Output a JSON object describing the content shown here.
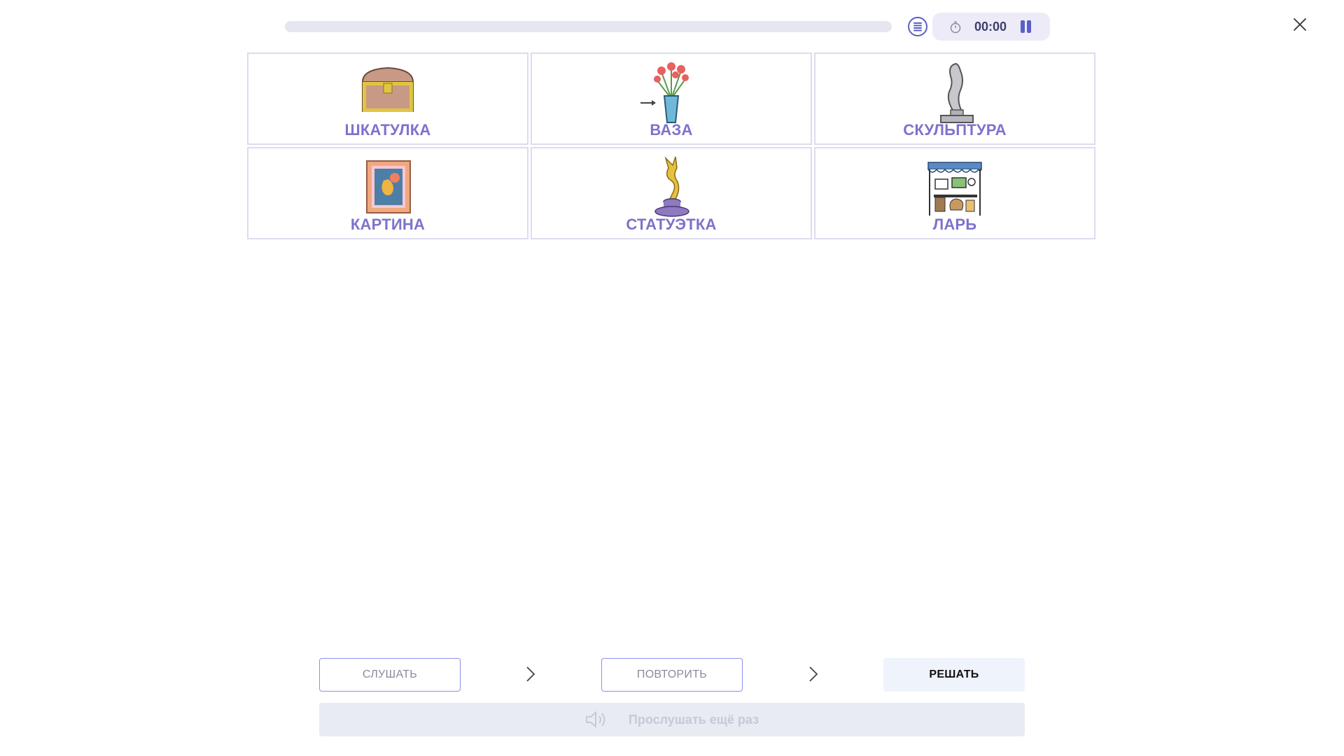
{
  "topbar": {
    "progress": 0,
    "timer": "00:00",
    "icons": {
      "list": "list-icon",
      "timer": "stopwatch-icon",
      "pause": "pause-icon",
      "close": "close-icon"
    }
  },
  "cards": [
    {
      "label": "ШКАТУЛКА",
      "icon": "chest-icon"
    },
    {
      "label": "ВАЗА",
      "icon": "vase-icon"
    },
    {
      "label": "СКУЛЬПТУРА",
      "icon": "sculpture-icon"
    },
    {
      "label": "КАРТИНА",
      "icon": "painting-icon"
    },
    {
      "label": "СТАТУЭТКА",
      "icon": "statuette-icon"
    },
    {
      "label": "ЛАРЬ",
      "icon": "stall-icon"
    }
  ],
  "steps": {
    "listen": "СЛУШАТЬ",
    "repeat": "ПОВТОРИТЬ",
    "solve": "РЕШАТЬ"
  },
  "listen_again": {
    "label": "Прослушать ещё раз",
    "icon": "speaker-icon"
  },
  "colors": {
    "accent": "#5a5fc8",
    "card_label": "#7d72cc",
    "card_border": "#dcdcf0"
  }
}
